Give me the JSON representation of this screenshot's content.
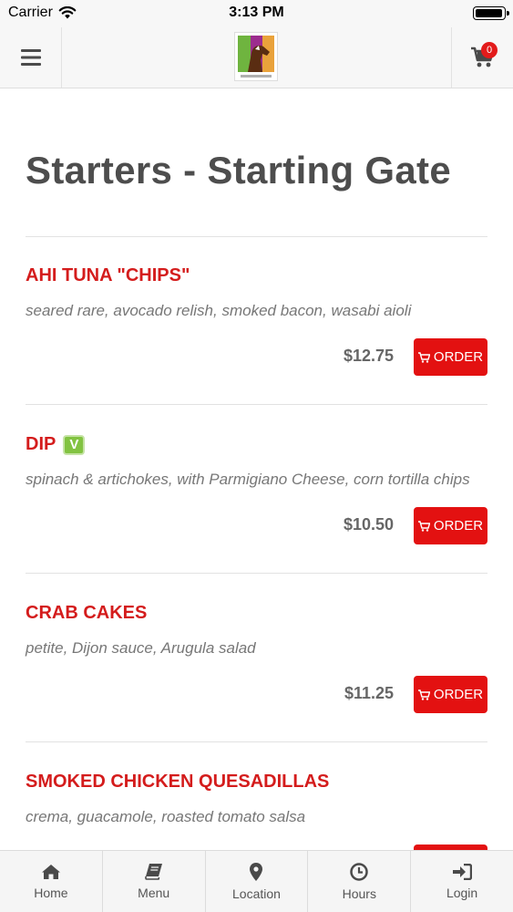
{
  "status_bar": {
    "carrier": "Carrier",
    "time": "3:13 PM",
    "battery_level": 0.95
  },
  "header": {
    "cart_count": "0"
  },
  "page": {
    "title": "Starters - Starting Gate"
  },
  "items": [
    {
      "name": "AHI TUNA \"CHIPS\"",
      "description": "seared rare, avocado relish, smoked bacon, wasabi aioli",
      "price": "$12.75",
      "order_label": "ORDER",
      "vegetarian": false
    },
    {
      "name": "DIP",
      "badge": "V",
      "description": "spinach & artichokes, with Parmigiano Cheese, corn tortilla chips",
      "price": "$10.50",
      "order_label": "ORDER",
      "vegetarian": true
    },
    {
      "name": "CRAB CAKES",
      "description": "petite, Dijon sauce, Arugula salad",
      "price": "$11.25",
      "order_label": "ORDER",
      "vegetarian": false
    },
    {
      "name": "SMOKED CHICKEN QUESADILLAS",
      "description": "crema, guacamole, roasted tomato salsa",
      "vegetarian": false
    }
  ],
  "tabs": [
    {
      "label": "Home",
      "icon": "home-icon"
    },
    {
      "label": "Menu",
      "icon": "book-icon"
    },
    {
      "label": "Location",
      "icon": "map-pin-icon"
    },
    {
      "label": "Hours",
      "icon": "clock-icon"
    },
    {
      "label": "Login",
      "icon": "login-icon"
    }
  ],
  "colors": {
    "accent": "#e31111",
    "item_title": "#d41c1c",
    "veg_badge": "#82c341"
  }
}
